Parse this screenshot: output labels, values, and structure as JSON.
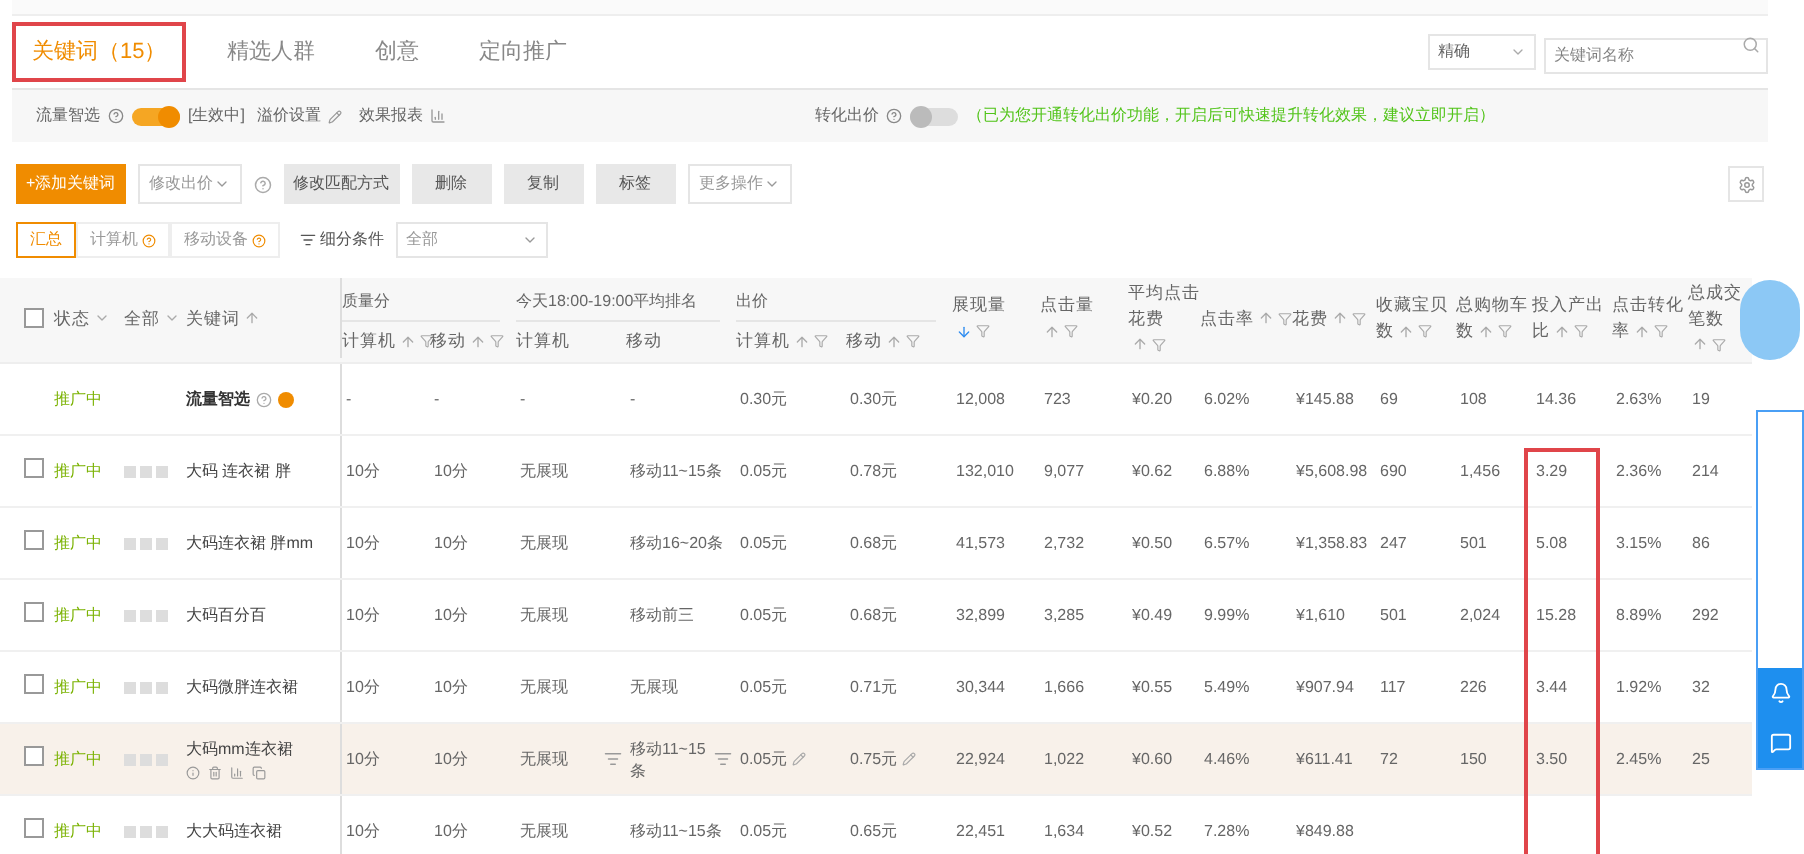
{
  "tabs": [
    {
      "label": "关键词（15）",
      "selected": true,
      "outlined": true
    },
    {
      "label": "精选人群",
      "selected": false,
      "outlined": false
    },
    {
      "label": "创意",
      "selected": false,
      "outlined": false
    },
    {
      "label": "定向推广",
      "selected": false,
      "outlined": false
    }
  ],
  "match_select": {
    "value": "精确"
  },
  "search": {
    "placeholder": "关键词名称"
  },
  "filter_bar": {
    "smart_label": "流量智选",
    "smart_on": true,
    "smart_status": "[生效中]",
    "premium_link": "溢价设置",
    "report_link": "效果报表",
    "conversion_label": "转化出价",
    "conversion_on": false,
    "conversion_note": "（已为您开通转化出价功能，开启后可快速提升转化效果，建议立即开启）"
  },
  "toolbar": [
    {
      "kind": "primary",
      "label": "+添加关键词"
    },
    {
      "kind": "dropdown",
      "label": "修改出价"
    },
    {
      "kind": "help"
    },
    {
      "kind": "gray",
      "label": "修改匹配方式"
    },
    {
      "kind": "gray",
      "label": "删除"
    },
    {
      "kind": "gray",
      "label": "复制"
    },
    {
      "kind": "gray",
      "label": "标签"
    },
    {
      "kind": "dropdown",
      "label": "更多操作"
    }
  ],
  "segments": [
    {
      "label": "汇总",
      "selected": true,
      "help": false
    },
    {
      "label": "计算机",
      "selected": false,
      "help": true
    },
    {
      "label": "移动设备",
      "selected": false,
      "help": true
    }
  ],
  "breakdown": {
    "label": "细分条件",
    "value": "全部"
  },
  "table": {
    "select_all": {
      "checked": false
    },
    "lead_columns": [
      {
        "label": "状态",
        "kind": "dropdown"
      },
      {
        "label": "全部",
        "kind": "dropdown"
      },
      {
        "label": "关键词",
        "kind": "sort"
      }
    ],
    "columns": [
      {
        "group": "质量分",
        "label": "计算机",
        "kind": "sortfilter",
        "outlined": false
      },
      {
        "in_group": true,
        "label": "移动",
        "kind": "sortfilter",
        "outlined": false
      },
      {
        "group": "今天18:00-19:00平均排名",
        "label": "计算机",
        "kind": "plain",
        "outlined": false
      },
      {
        "in_group": true,
        "label": "移动",
        "kind": "plain",
        "outlined": false
      },
      {
        "group": "出价",
        "label": "计算机",
        "kind": "sortfilter",
        "outlined": false
      },
      {
        "in_group": true,
        "label": "移动",
        "kind": "sortfilter",
        "outlined": false
      },
      {
        "label": "展现量",
        "kind": "sortfilter",
        "sorted": true,
        "outlined": false
      },
      {
        "label": "点击量",
        "kind": "sortfilter",
        "sorted": false,
        "outlined": false
      },
      {
        "label": "平均点击花费",
        "kind": "sortfilter",
        "sorted": false,
        "outlined": false
      },
      {
        "label": "点击率",
        "kind": "sortfilter",
        "sorted": false,
        "outlined": false
      },
      {
        "label": "花费",
        "kind": "sortfilter",
        "sorted": false,
        "outlined": false
      },
      {
        "label": "收藏宝贝数",
        "kind": "sortfilter",
        "sorted": false,
        "outlined": false
      },
      {
        "label": "总购物车数",
        "kind": "sortfilter",
        "sorted": false,
        "outlined": false
      },
      {
        "label": "投入产出比",
        "kind": "sortfilter",
        "sorted": false,
        "outlined": true
      },
      {
        "label": "点击转化率",
        "kind": "sortfilter",
        "sorted": false,
        "outlined": false
      },
      {
        "label": "总成交笔数",
        "kind": "sortfilter",
        "sorted": false,
        "outlined": false
      }
    ],
    "rows": [
      {
        "kind": "smart",
        "status": "推广中",
        "keyword": "流量智选",
        "highlighted": false,
        "cells": [
          "-",
          "-",
          "-",
          "-",
          "0.30元",
          "0.30元",
          "12,008",
          "723",
          "¥0.20",
          "6.02%",
          "¥145.88",
          "69",
          "108",
          "14.36",
          "2.63%",
          "19"
        ]
      },
      {
        "kind": "keyword",
        "checked": false,
        "status": "推广中",
        "keyword": "大码 连衣裙 胖",
        "highlighted": false,
        "cells": [
          "10分",
          "10分",
          "无展现",
          "移动11~15条",
          "0.05元",
          "0.78元",
          "132,010",
          "9,077",
          "¥0.62",
          "6.88%",
          "¥5,608.98",
          "690",
          "1,456",
          "3.29",
          "2.36%",
          "214"
        ]
      },
      {
        "kind": "keyword",
        "checked": false,
        "status": "推广中",
        "keyword": "大码连衣裙 胖mm",
        "highlighted": false,
        "cells": [
          "10分",
          "10分",
          "无展现",
          "移动16~20条",
          "0.05元",
          "0.68元",
          "41,573",
          "2,732",
          "¥0.50",
          "6.57%",
          "¥1,358.83",
          "247",
          "501",
          "5.08",
          "3.15%",
          "86"
        ]
      },
      {
        "kind": "keyword",
        "checked": false,
        "status": "推广中",
        "keyword": "大码百分百",
        "highlighted": false,
        "cells": [
          "10分",
          "10分",
          "无展现",
          "移动前三",
          "0.05元",
          "0.68元",
          "32,899",
          "3,285",
          "¥0.49",
          "9.99%",
          "¥1,610",
          "501",
          "2,024",
          "15.28",
          "8.89%",
          "292"
        ]
      },
      {
        "kind": "keyword",
        "checked": false,
        "status": "推广中",
        "keyword": "大码微胖连衣裙",
        "highlighted": false,
        "cells": [
          "10分",
          "10分",
          "无展现",
          "无展现",
          "0.05元",
          "0.71元",
          "30,344",
          "1,666",
          "¥0.55",
          "5.49%",
          "¥907.94",
          "117",
          "226",
          "3.44",
          "1.92%",
          "32"
        ]
      },
      {
        "kind": "keyword",
        "checked": false,
        "status": "推广中",
        "keyword": "大码mm连衣裙",
        "highlighted": true,
        "cells": [
          "10分",
          "10分",
          "无展现",
          "移动11~15条",
          "0.05元",
          "0.75元",
          "22,924",
          "1,022",
          "¥0.60",
          "4.46%",
          "¥611.41",
          "72",
          "150",
          "3.50",
          "2.45%",
          "25"
        ]
      },
      {
        "kind": "keyword",
        "checked": false,
        "status": "推广中",
        "keyword": "大大码连衣裙",
        "highlighted": false,
        "cells": [
          "10分",
          "10分",
          "无展现",
          "移动11~15条",
          "0.05元",
          "0.65元",
          "22,451",
          "1,634",
          "¥0.52",
          "7.28%",
          "¥849.88"
        ]
      }
    ]
  }
}
